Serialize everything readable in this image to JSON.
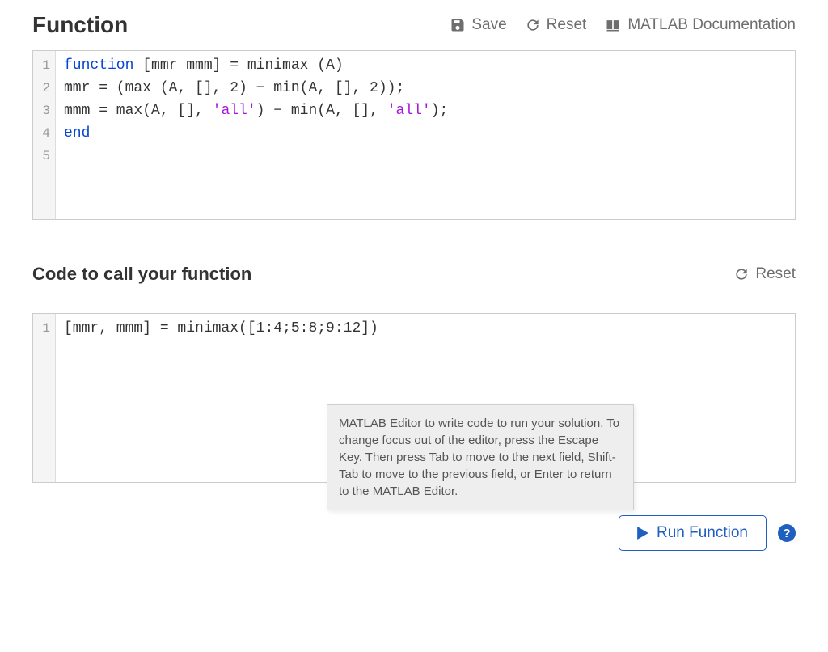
{
  "section1": {
    "title": "Function",
    "toolbar": {
      "save": "Save",
      "reset": "Reset",
      "docs": "MATLAB Documentation"
    }
  },
  "editor1": {
    "gutter": [
      "1",
      "2",
      "3",
      "4",
      "5"
    ],
    "line1_kw": "function",
    "line1_rest": " [mmr mmm] = minimax (A)",
    "line2": "mmr = (max (A, [], 2) − min(A, [], 2));",
    "line3_a": "mmm = max(A, [], ",
    "line3_s1": "'all'",
    "line3_b": ") − min(A, [], ",
    "line3_s2": "'all'",
    "line3_c": ");",
    "line4_kw": "end"
  },
  "section2": {
    "title": "Code to call your function",
    "reset": "Reset"
  },
  "editor2": {
    "gutter": [
      "1"
    ],
    "line1": "[mmr, mmm] = minimax([1:4;5:8;9:12])"
  },
  "tooltip": "MATLAB Editor to write code to run your solution. To change focus out of the editor, press the Escape Key. Then press Tab to move to the next field, Shift-Tab to move to the previous field, or Enter to return to the MATLAB Editor.",
  "run_button": "Run Function",
  "help": "?"
}
